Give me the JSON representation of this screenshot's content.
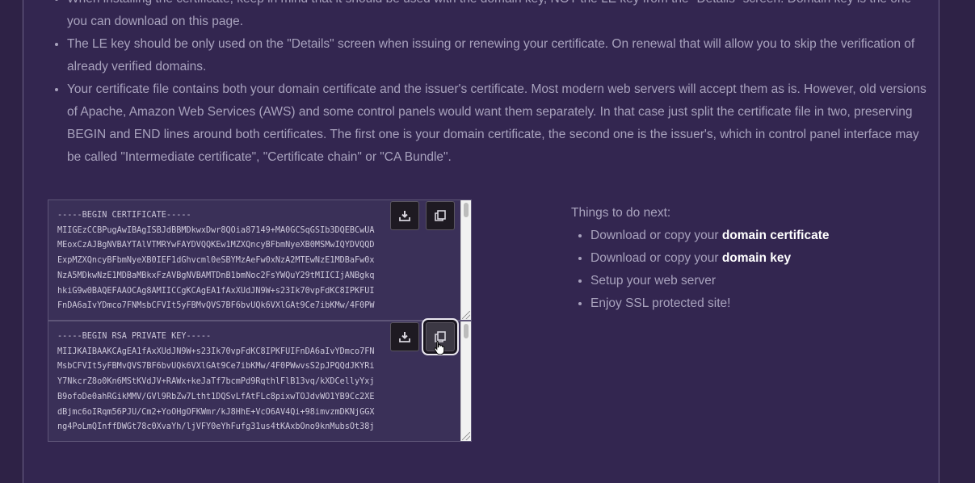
{
  "notes": [
    "When installing the certificate, keep in mind that it should be used with the domain key, NOT the LE key from the \"Details\" screen. Domain key is the one you can download on this page.",
    "The LE key should be only used on the \"Details\" screen when issuing or renewing your certificate. On renewal that will allow you to skip the verification of already verified domains.",
    "Your certificate file contains both your domain certificate and the issuer's certificate. Most modern web servers will accept them as is. However, old versions of Apache, Amazon Web Services (AWS) and some control panels would want them separately. In that case just split the certificate file in two, preserving BEGIN and END lines around both certificates. The first one is your domain certificate, the second one is the issuer's, which in control panel interface may be called \"Intermediate certificate\", \"Certificate chain\" or \"CA Bundle\"."
  ],
  "certificate": {
    "text": "-----BEGIN CERTIFICATE-----\nMIIGEzCCBPugAwIBAgISBJdBBMDkwxDwr8QOia87149+MA0GCSqGSIb3DQEBCwUA\nMEoxCzAJBgNVBAYTAlVTMRYwFAYDVQQKEw1MZXQncyBFbmNyeXB0MSMwIQYDVQQD\nExpMZXQncyBFbmNyeXB0IEF1dGhvcml0eSBYMzAeFw0xNzA2MTEwNzE1MDBaFw0x\nNzA5MDkwNzE1MDBaMBkxFzAVBgNVBAMTDnB1bmNoc2FsYWQuY29tMIICIjANBgkq\nhkiG9w0BAQEFAAOCAg8AMIICCgKCAgEA1fAxXUdJN9W+s23Ik70vpFdKC8IPKFUI\nFnDA6aIvYDmco7FNMsbCFVIt5yFBMvQVS7BF6bvUQk6VXlGAt9Ce7ibKMw/4F0PW"
  },
  "private_key": {
    "text": "-----BEGIN RSA PRIVATE KEY-----\nMIIJKAIBAAKCAgEA1fAxXUdJN9W+s23Ik70vpFdKC8IPKFUIFnDA6aIvYDmco7FN\nMsbCFVIt5yFBMvQVS7BF6bvUQk6VXlGAt9Ce7ibKMw/4F0PWwvsS2pJPQQdJKYRi\nY7NkcrZ8o0Kn6MStKVdJV+RAWx+keJaTf7bcmPd9RqthlFlB13vq/kXDCellyYxj\nB9ofoDe0ahRGikMMV/GVl9RbZw7Ltht1DQSvLfAtFLc8pixwTOJdvWO1YB9Cc2XE\ndBjmc6oIRqm56PJU/Cm2+YoOHgOFKWmr/kJ8HhE+VcO6AV4Qi+98imvzmDKNjGGX\nng4PoLmQInffDWGt78c0XvaYh/ljVFY0eYhFufg31us4tKAxbOno9knMubsOt38j"
  },
  "buttons": {
    "download_icon": "download-icon",
    "copy_icon": "copy-icon"
  },
  "next_steps": {
    "title": "Things to do next:",
    "items": [
      {
        "text": "Download or copy your ",
        "bold": "domain certificate"
      },
      {
        "text": "Download or copy your ",
        "bold": "domain key"
      },
      {
        "text": "Setup your web server",
        "bold": ""
      },
      {
        "text": "Enjoy SSL protected site!",
        "bold": ""
      }
    ]
  },
  "colors": {
    "background": "#2e2246",
    "panel": "#332650",
    "text": "#a8a2bd",
    "highlight": "#ffffff"
  }
}
